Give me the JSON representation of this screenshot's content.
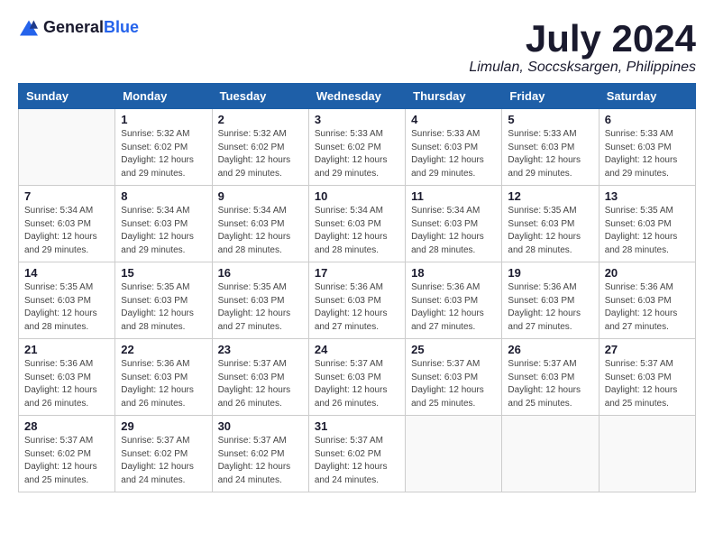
{
  "logo": {
    "general": "General",
    "blue": "Blue"
  },
  "title": {
    "month": "July 2024",
    "location": "Limulan, Soccsksargen, Philippines"
  },
  "headers": [
    "Sunday",
    "Monday",
    "Tuesday",
    "Wednesday",
    "Thursday",
    "Friday",
    "Saturday"
  ],
  "weeks": [
    [
      {
        "day": "",
        "info": ""
      },
      {
        "day": "1",
        "info": "Sunrise: 5:32 AM\nSunset: 6:02 PM\nDaylight: 12 hours\nand 29 minutes."
      },
      {
        "day": "2",
        "info": "Sunrise: 5:32 AM\nSunset: 6:02 PM\nDaylight: 12 hours\nand 29 minutes."
      },
      {
        "day": "3",
        "info": "Sunrise: 5:33 AM\nSunset: 6:02 PM\nDaylight: 12 hours\nand 29 minutes."
      },
      {
        "day": "4",
        "info": "Sunrise: 5:33 AM\nSunset: 6:03 PM\nDaylight: 12 hours\nand 29 minutes."
      },
      {
        "day": "5",
        "info": "Sunrise: 5:33 AM\nSunset: 6:03 PM\nDaylight: 12 hours\nand 29 minutes."
      },
      {
        "day": "6",
        "info": "Sunrise: 5:33 AM\nSunset: 6:03 PM\nDaylight: 12 hours\nand 29 minutes."
      }
    ],
    [
      {
        "day": "7",
        "info": "Sunrise: 5:34 AM\nSunset: 6:03 PM\nDaylight: 12 hours\nand 29 minutes."
      },
      {
        "day": "8",
        "info": "Sunrise: 5:34 AM\nSunset: 6:03 PM\nDaylight: 12 hours\nand 29 minutes."
      },
      {
        "day": "9",
        "info": "Sunrise: 5:34 AM\nSunset: 6:03 PM\nDaylight: 12 hours\nand 28 minutes."
      },
      {
        "day": "10",
        "info": "Sunrise: 5:34 AM\nSunset: 6:03 PM\nDaylight: 12 hours\nand 28 minutes."
      },
      {
        "day": "11",
        "info": "Sunrise: 5:34 AM\nSunset: 6:03 PM\nDaylight: 12 hours\nand 28 minutes."
      },
      {
        "day": "12",
        "info": "Sunrise: 5:35 AM\nSunset: 6:03 PM\nDaylight: 12 hours\nand 28 minutes."
      },
      {
        "day": "13",
        "info": "Sunrise: 5:35 AM\nSunset: 6:03 PM\nDaylight: 12 hours\nand 28 minutes."
      }
    ],
    [
      {
        "day": "14",
        "info": "Sunrise: 5:35 AM\nSunset: 6:03 PM\nDaylight: 12 hours\nand 28 minutes."
      },
      {
        "day": "15",
        "info": "Sunrise: 5:35 AM\nSunset: 6:03 PM\nDaylight: 12 hours\nand 28 minutes."
      },
      {
        "day": "16",
        "info": "Sunrise: 5:35 AM\nSunset: 6:03 PM\nDaylight: 12 hours\nand 27 minutes."
      },
      {
        "day": "17",
        "info": "Sunrise: 5:36 AM\nSunset: 6:03 PM\nDaylight: 12 hours\nand 27 minutes."
      },
      {
        "day": "18",
        "info": "Sunrise: 5:36 AM\nSunset: 6:03 PM\nDaylight: 12 hours\nand 27 minutes."
      },
      {
        "day": "19",
        "info": "Sunrise: 5:36 AM\nSunset: 6:03 PM\nDaylight: 12 hours\nand 27 minutes."
      },
      {
        "day": "20",
        "info": "Sunrise: 5:36 AM\nSunset: 6:03 PM\nDaylight: 12 hours\nand 27 minutes."
      }
    ],
    [
      {
        "day": "21",
        "info": "Sunrise: 5:36 AM\nSunset: 6:03 PM\nDaylight: 12 hours\nand 26 minutes."
      },
      {
        "day": "22",
        "info": "Sunrise: 5:36 AM\nSunset: 6:03 PM\nDaylight: 12 hours\nand 26 minutes."
      },
      {
        "day": "23",
        "info": "Sunrise: 5:37 AM\nSunset: 6:03 PM\nDaylight: 12 hours\nand 26 minutes."
      },
      {
        "day": "24",
        "info": "Sunrise: 5:37 AM\nSunset: 6:03 PM\nDaylight: 12 hours\nand 26 minutes."
      },
      {
        "day": "25",
        "info": "Sunrise: 5:37 AM\nSunset: 6:03 PM\nDaylight: 12 hours\nand 25 minutes."
      },
      {
        "day": "26",
        "info": "Sunrise: 5:37 AM\nSunset: 6:03 PM\nDaylight: 12 hours\nand 25 minutes."
      },
      {
        "day": "27",
        "info": "Sunrise: 5:37 AM\nSunset: 6:03 PM\nDaylight: 12 hours\nand 25 minutes."
      }
    ],
    [
      {
        "day": "28",
        "info": "Sunrise: 5:37 AM\nSunset: 6:02 PM\nDaylight: 12 hours\nand 25 minutes."
      },
      {
        "day": "29",
        "info": "Sunrise: 5:37 AM\nSunset: 6:02 PM\nDaylight: 12 hours\nand 24 minutes."
      },
      {
        "day": "30",
        "info": "Sunrise: 5:37 AM\nSunset: 6:02 PM\nDaylight: 12 hours\nand 24 minutes."
      },
      {
        "day": "31",
        "info": "Sunrise: 5:37 AM\nSunset: 6:02 PM\nDaylight: 12 hours\nand 24 minutes."
      },
      {
        "day": "",
        "info": ""
      },
      {
        "day": "",
        "info": ""
      },
      {
        "day": "",
        "info": ""
      }
    ]
  ]
}
